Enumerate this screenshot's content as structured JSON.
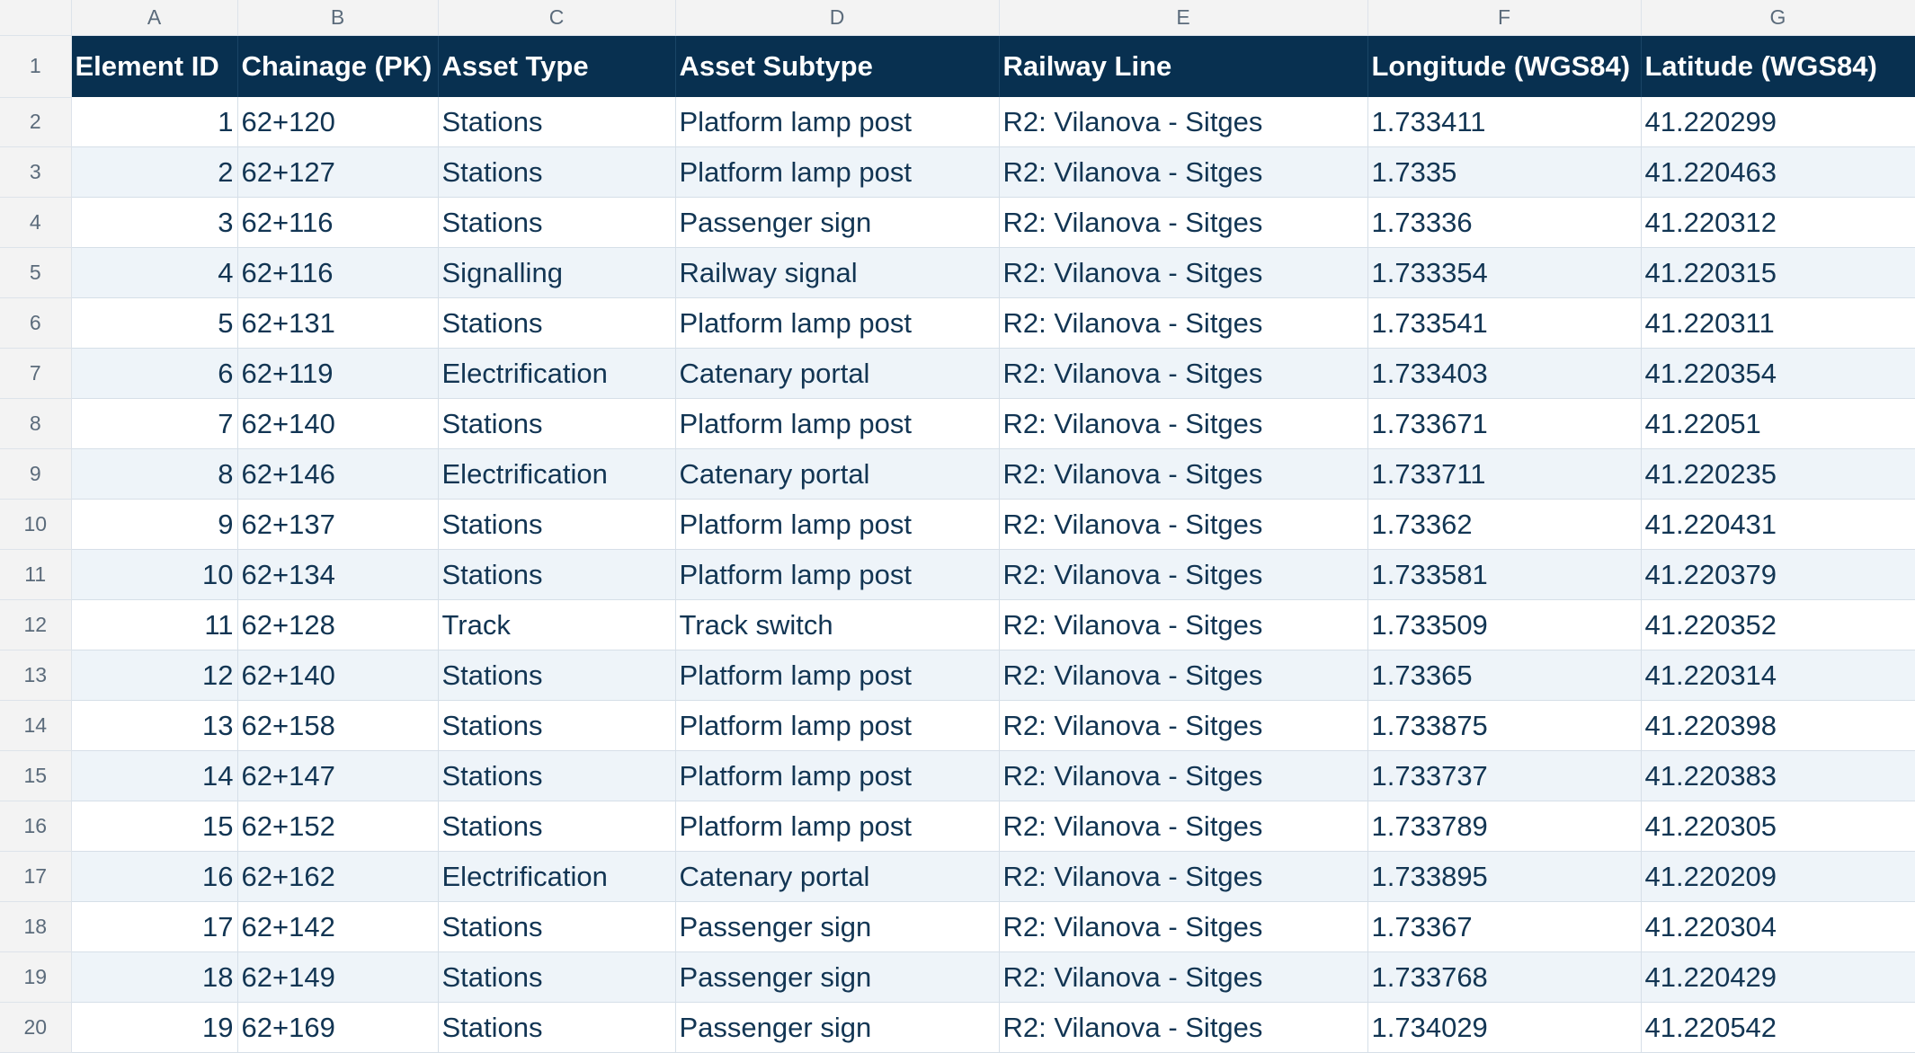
{
  "column_letters": [
    "A",
    "B",
    "C",
    "D",
    "E",
    "F",
    "G"
  ],
  "headers": [
    "Element ID",
    "Chainage (PK)",
    "Asset Type",
    "Asset Subtype",
    "Railway Line",
    "Longitude (WGS84)",
    "Latitude (WGS84)"
  ],
  "row_numbers": [
    "1",
    "2",
    "3",
    "4",
    "5",
    "6",
    "7",
    "8",
    "9",
    "10",
    "11",
    "12",
    "13",
    "14",
    "15",
    "16",
    "17",
    "18",
    "19",
    "20"
  ],
  "rows": [
    [
      "1",
      "62+120",
      "Stations",
      "Platform lamp post",
      "R2: Vilanova - Sitges",
      "1.733411",
      "41.220299"
    ],
    [
      "2",
      "62+127",
      "Stations",
      "Platform lamp post",
      "R2: Vilanova - Sitges",
      "1.7335",
      "41.220463"
    ],
    [
      "3",
      "62+116",
      "Stations",
      "Passenger sign",
      "R2: Vilanova - Sitges",
      "1.73336",
      "41.220312"
    ],
    [
      "4",
      "62+116",
      "Signalling",
      "Railway signal",
      "R2: Vilanova - Sitges",
      "1.733354",
      "41.220315"
    ],
    [
      "5",
      "62+131",
      "Stations",
      "Platform lamp post",
      "R2: Vilanova - Sitges",
      "1.733541",
      "41.220311"
    ],
    [
      "6",
      "62+119",
      "Electrification",
      "Catenary portal",
      "R2: Vilanova - Sitges",
      "1.733403",
      "41.220354"
    ],
    [
      "7",
      "62+140",
      "Stations",
      "Platform lamp post",
      "R2: Vilanova - Sitges",
      "1.733671",
      "41.22051"
    ],
    [
      "8",
      "62+146",
      "Electrification",
      "Catenary portal",
      "R2: Vilanova - Sitges",
      "1.733711",
      "41.220235"
    ],
    [
      "9",
      "62+137",
      "Stations",
      "Platform lamp post",
      "R2: Vilanova - Sitges",
      "1.73362",
      "41.220431"
    ],
    [
      "10",
      "62+134",
      "Stations",
      "Platform lamp post",
      "R2: Vilanova - Sitges",
      "1.733581",
      "41.220379"
    ],
    [
      "11",
      "62+128",
      "Track",
      "Track switch",
      "R2: Vilanova - Sitges",
      "1.733509",
      "41.220352"
    ],
    [
      "12",
      "62+140",
      "Stations",
      "Platform lamp post",
      "R2: Vilanova - Sitges",
      "1.73365",
      "41.220314"
    ],
    [
      "13",
      "62+158",
      "Stations",
      "Platform lamp post",
      "R2: Vilanova - Sitges",
      "1.733875",
      "41.220398"
    ],
    [
      "14",
      "62+147",
      "Stations",
      "Platform lamp post",
      "R2: Vilanova - Sitges",
      "1.733737",
      "41.220383"
    ],
    [
      "15",
      "62+152",
      "Stations",
      "Platform lamp post",
      "R2: Vilanova - Sitges",
      "1.733789",
      "41.220305"
    ],
    [
      "16",
      "62+162",
      "Electrification",
      "Catenary portal",
      "R2: Vilanova - Sitges",
      "1.733895",
      "41.220209"
    ],
    [
      "17",
      "62+142",
      "Stations",
      "Passenger sign",
      "R2: Vilanova - Sitges",
      "1.73367",
      "41.220304"
    ],
    [
      "18",
      "62+149",
      "Stations",
      "Passenger sign",
      "R2: Vilanova - Sitges",
      "1.733768",
      "41.220429"
    ],
    [
      "19",
      "62+169",
      "Stations",
      "Passenger sign",
      "R2: Vilanova - Sitges",
      "1.734029",
      "41.220542"
    ]
  ],
  "colors": {
    "header_bg": "#083050",
    "header_text": "#ffffff",
    "alt_row_bg": "#eef4f9",
    "cell_text": "#123553",
    "gutter_bg": "#f3f3f3"
  }
}
